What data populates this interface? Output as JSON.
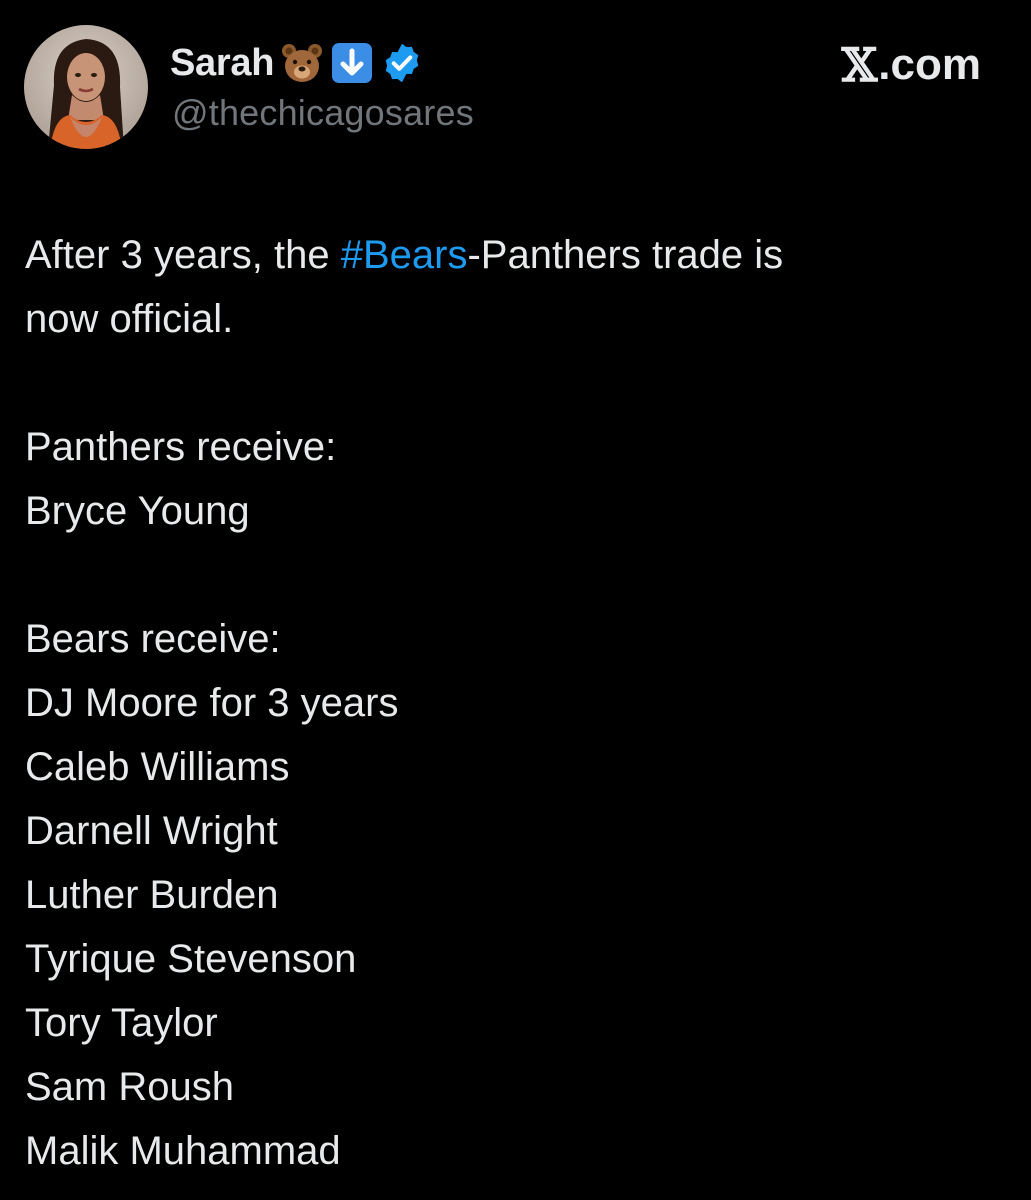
{
  "author": {
    "display_name": "Sarah",
    "badges": [
      "bear-emoji",
      "down-arrow-emoji",
      "verified-badge"
    ],
    "handle": "@thechicagosares"
  },
  "site": {
    "label": ".com",
    "logo": "x-logo"
  },
  "tweet": {
    "intro_before": "After 3 years, the ",
    "hashtag": "#Bears",
    "intro_after": "-Panthers trade is",
    "intro_line2": "now official.",
    "panthers_heading": "Panthers receive:",
    "panthers_players": [
      "Bryce Young"
    ],
    "bears_heading": "Bears receive:",
    "bears_players": [
      "DJ Moore for 3 years",
      "Caleb Williams",
      "Darnell Wright",
      "Luther Burden",
      "Tyrique Stevenson",
      "Tory Taylor",
      "Sam Roush",
      "Malik Muhammad"
    ]
  },
  "colors": {
    "background": "#000000",
    "text": "#e7e9ea",
    "secondary_text": "#71767b",
    "link": "#1d9bf0"
  }
}
